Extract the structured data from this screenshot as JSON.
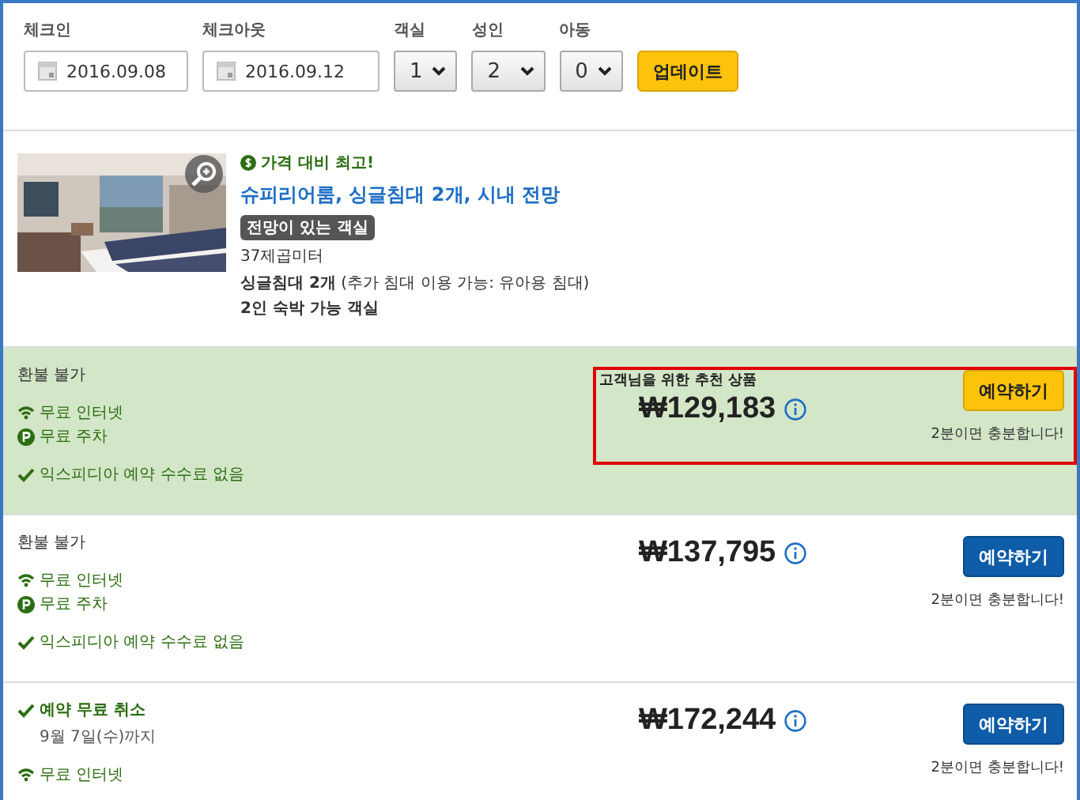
{
  "search": {
    "checkin": {
      "label": "체크인",
      "value": "2016.09.08"
    },
    "checkout": {
      "label": "체크아웃",
      "value": "2016.09.12"
    },
    "selects": [
      {
        "label": "객실",
        "value": "1"
      },
      {
        "label": "성인",
        "value": "2"
      },
      {
        "label": "아동",
        "value": "0"
      }
    ],
    "update_button": "업데이트"
  },
  "room": {
    "deal_badge": "가격 대비 최고!",
    "title": "슈피리어룸, 싱글침대 2개, 시내 전망",
    "tag": "전망이 있는 객실",
    "size": "37제곱미터",
    "beds": "**싱글침대 2개** (추가 침대 이용 가능: 유아용 침대)",
    "occupancy": "2인 숙박 가능 객실"
  },
  "rates": [
    {
      "recommended": true,
      "annotated": true,
      "cancellation": {
        "kind": "plain",
        "text": "환불 불가"
      },
      "amenities": [
        {
          "kind": "wifi",
          "text": "무료 인터넷"
        },
        {
          "kind": "parking",
          "text": "무료 주차"
        }
      ],
      "fee_note": "익스피디아 예약 수수료 없음",
      "recommend_label": "고객님을 위한 추천 상품",
      "price": "₩129,183",
      "button": "예약하기",
      "note": "2분이면 충분합니다!"
    },
    {
      "recommended": false,
      "annotated": false,
      "cancellation": {
        "kind": "plain",
        "text": "환불 불가"
      },
      "amenities": [
        {
          "kind": "wifi",
          "text": "무료 인터넷"
        },
        {
          "kind": "parking",
          "text": "무료 주차"
        }
      ],
      "fee_note": "익스피디아 예약 수수료 없음",
      "price": "₩137,795",
      "button": "예약하기",
      "note": "2분이면 충분합니다!"
    },
    {
      "recommended": false,
      "annotated": false,
      "cancellation": {
        "kind": "free",
        "text": "예약 무료 취소",
        "detail": "9월 7일(수)까지"
      },
      "amenities": [
        {
          "kind": "wifi",
          "text": "무료 인터넷"
        }
      ],
      "price": "₩172,244",
      "button": "예약하기",
      "note": "2분이면 충분합니다!"
    }
  ]
}
